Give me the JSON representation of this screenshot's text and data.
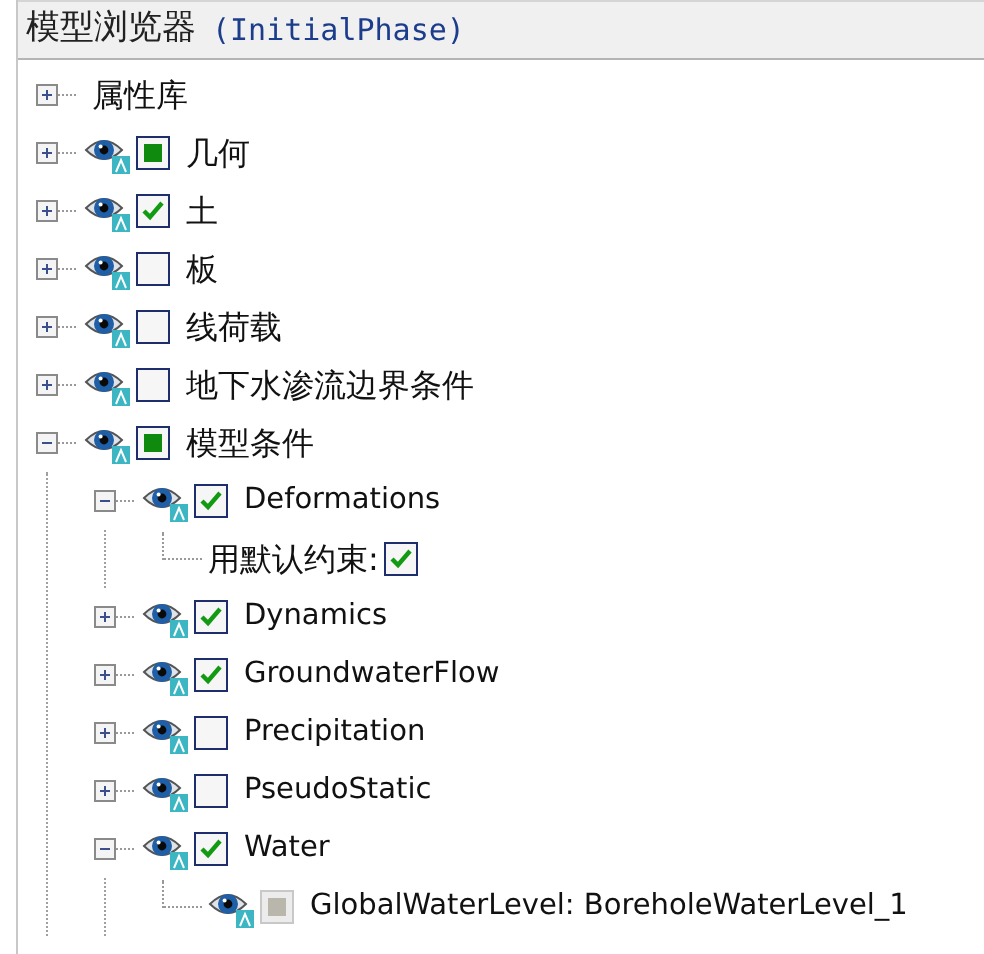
{
  "panel": {
    "title": "模型浏览器",
    "phase": "(InitialPhase)"
  },
  "tree": [
    {
      "kind": "folder",
      "label": "属性库",
      "expanded": false
    },
    {
      "kind": "layer",
      "label": "几何",
      "expanded": false,
      "checked": false,
      "partial": true,
      "disabled": false
    },
    {
      "kind": "layer",
      "label": "土",
      "expanded": false,
      "checked": true,
      "partial": false,
      "disabled": false
    },
    {
      "kind": "layer",
      "label": "板",
      "expanded": false,
      "checked": false,
      "partial": false,
      "disabled": false
    },
    {
      "kind": "layer",
      "label": "线荷载",
      "expanded": false,
      "checked": false,
      "partial": false,
      "disabled": false
    },
    {
      "kind": "layer",
      "label": "地下水渗流边界条件",
      "expanded": false,
      "checked": false,
      "partial": false,
      "disabled": false
    },
    {
      "kind": "layer",
      "label": "模型条件",
      "expanded": true,
      "checked": false,
      "partial": true,
      "disabled": false,
      "children": [
        {
          "kind": "layer",
          "label": "Deformations",
          "expanded": true,
          "checked": true,
          "partial": false,
          "disabled": false,
          "children": [
            {
              "kind": "option",
              "label": "用默认约束:",
              "checked": true,
              "partial": false,
              "disabled": false
            }
          ]
        },
        {
          "kind": "layer",
          "label": "Dynamics",
          "expanded": false,
          "checked": true,
          "partial": false,
          "disabled": false
        },
        {
          "kind": "layer",
          "label": "GroundwaterFlow",
          "expanded": false,
          "checked": true,
          "partial": false,
          "disabled": false
        },
        {
          "kind": "layer",
          "label": "Precipitation",
          "expanded": false,
          "checked": false,
          "partial": false,
          "disabled": false
        },
        {
          "kind": "layer",
          "label": "PseudoStatic",
          "expanded": false,
          "checked": false,
          "partial": false,
          "disabled": false
        },
        {
          "kind": "layer",
          "label": "Water",
          "expanded": true,
          "checked": true,
          "partial": false,
          "disabled": false,
          "children": [
            {
              "kind": "layer",
              "label": "GlobalWaterLevel: BoreholeWaterLevel_1",
              "checked": false,
              "partial": true,
              "disabled": true
            }
          ]
        }
      ]
    }
  ]
}
